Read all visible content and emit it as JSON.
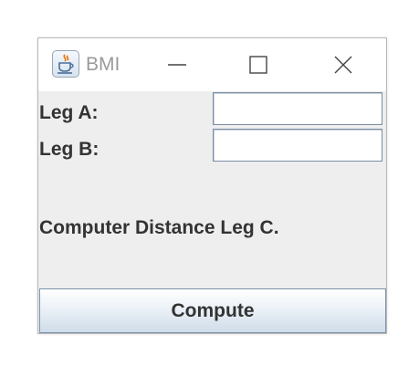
{
  "window": {
    "title": "BMI",
    "app_icon": "java-cup-icon",
    "controls": [
      "minimize-icon",
      "maximize-icon",
      "close-icon"
    ]
  },
  "form": {
    "leg_a_label": "Leg A:",
    "leg_a_value": "",
    "leg_b_label": "Leg B:",
    "leg_b_value": "",
    "result_text": "Computer Distance Leg C.",
    "compute_label": "Compute"
  }
}
